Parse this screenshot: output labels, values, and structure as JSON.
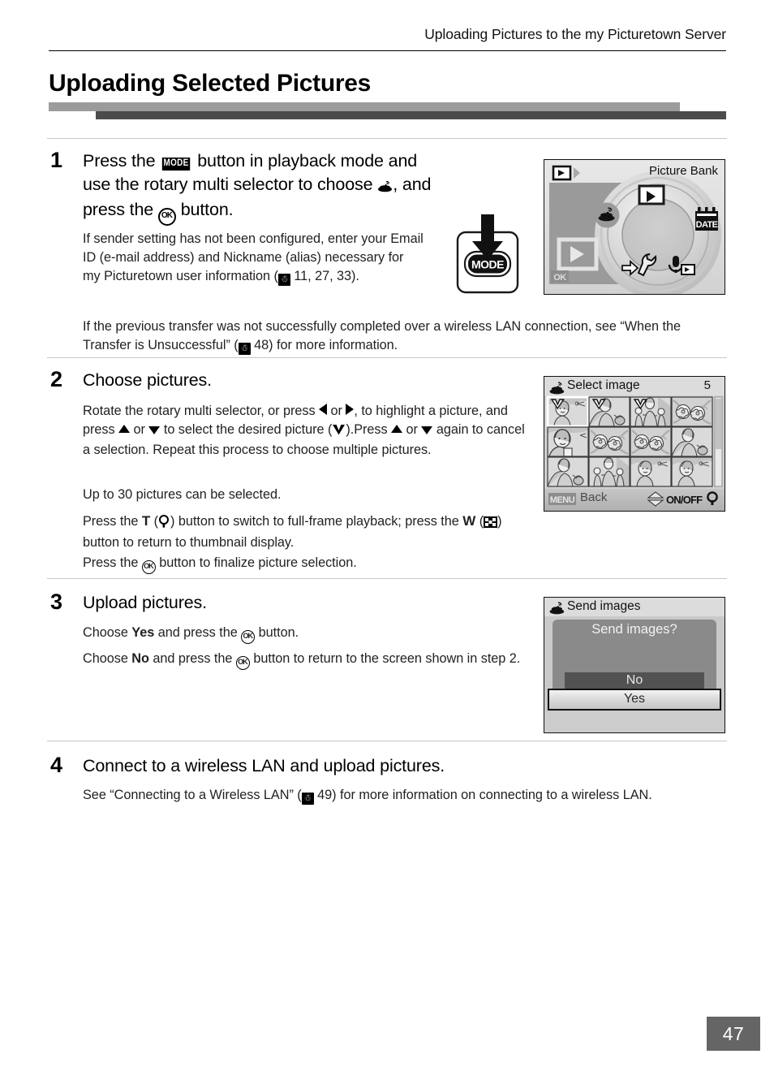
{
  "header": {
    "running_title": "Uploading Pictures to the my Picturetown Server"
  },
  "chapter": {
    "title": "Uploading Selected Pictures"
  },
  "steps": [
    {
      "number": "1",
      "heading_parts": {
        "a": "Press the ",
        "mode_icon": "MODE",
        "b": " button in playback mode and use the rotary multi selector to choose ",
        "send_icon": "send-images-icon",
        "c": ", and press the ",
        "ok_icon": "OK",
        "d": " button."
      },
      "body": [
        "If sender setting has not been configured, enter your Email ID (e-mail address) and Nickname (alias) necessary for my Picturetown user information (",
        "11, 27, 33).",
        "If the previous transfer was not successfully completed over a wireless LAN connection, see “When the Transfer is Unsuccessful” (",
        "48) for more information."
      ]
    },
    {
      "number": "2",
      "heading": "Choose pictures.",
      "body": {
        "p1_a": "Rotate the rotary multi selector, or press ",
        "p1_b": " or ",
        "p1_c": ", to highlight a picture, and press ",
        "p1_d": " or ",
        "p1_e": " to select the desired picture (",
        "p1_f": ").",
        "p2_a": "Press ",
        "p2_b": " or ",
        "p2_c": " again to cancel a selection. Repeat this process to choose multiple pictures.",
        "p3": "Up to 30 pictures can be selected.",
        "p4_a": "Press the ",
        "p4_t": "T",
        "p4_b": " (",
        "p4_c": ") button to switch to full-frame playback; press the ",
        "p4_w": "W",
        "p4_d": " (",
        "p4_e": ") button to return to thumbnail display.",
        "p5_a": "Press the ",
        "p5_ok": "OK",
        "p5_b": " button to finalize picture selection."
      }
    },
    {
      "number": "3",
      "heading": "Upload pictures.",
      "body": {
        "p1_a": "Choose ",
        "p1_yes": "Yes",
        "p1_b": " and press the ",
        "p1_ok": "OK",
        "p1_c": " button.",
        "p2_a": "Choose ",
        "p2_no": "No",
        "p2_b": " and press the ",
        "p2_ok": "OK",
        "p2_c": " button to return to the screen shown in step 2."
      }
    },
    {
      "number": "4",
      "heading": "Connect to a wireless LAN and upload pictures.",
      "body": {
        "p1_a": "See “Connecting to a Wireless LAN” (",
        "p1_ref": "49",
        "p1_b": ") for more information on connecting to a wireless LAN."
      }
    }
  ],
  "screens": {
    "picture_bank": {
      "title": "Picture Bank",
      "playback_icon": "playback-icon",
      "ok_label": "OK",
      "dial_items": [
        {
          "name": "playback-icon",
          "label": ""
        },
        {
          "name": "date-icon",
          "label": "DATE"
        },
        {
          "name": "voice-recording-icon",
          "label": ""
        },
        {
          "name": "setup-wrench-icon",
          "label": ""
        },
        {
          "name": "send-images-icon",
          "label": ""
        }
      ]
    },
    "select_image": {
      "icon": "send-images-icon",
      "title": "Select image",
      "count": "5",
      "menu_key": "MENU",
      "back_label": "Back",
      "onoff_label": "ON/OFF",
      "zoom_icon": "magnifier-icon",
      "thumbnails": [
        {
          "kind": "woman-landscape",
          "selected": true,
          "highlighted": true
        },
        {
          "kind": "woman-bag",
          "selected": true,
          "highlighted": false
        },
        {
          "kind": "family-group",
          "selected": true,
          "highlighted": false
        },
        {
          "kind": "flowers",
          "selected": false,
          "highlighted": false
        },
        {
          "kind": "woman-portrait",
          "selected": false,
          "highlighted": false
        },
        {
          "kind": "flowers",
          "selected": false,
          "highlighted": false
        },
        {
          "kind": "flowers",
          "selected": false,
          "highlighted": false
        },
        {
          "kind": "woman-bag",
          "selected": false,
          "highlighted": false
        },
        {
          "kind": "woman-bag",
          "selected": false,
          "highlighted": false
        },
        {
          "kind": "family-group",
          "selected": false,
          "highlighted": false
        },
        {
          "kind": "woman-landscape",
          "selected": false,
          "highlighted": false
        },
        {
          "kind": "woman-landscape",
          "selected": false,
          "highlighted": false
        }
      ]
    },
    "send_images": {
      "icon": "send-images-icon",
      "title": "Send images",
      "prompt": "Send images?",
      "option_no": "No",
      "option_yes": "Yes",
      "selected_option": "Yes"
    }
  },
  "footer": {
    "page_number": "47"
  },
  "colors": {
    "bar_light": "#9b9b9b",
    "bar_dark": "#4b4b4b",
    "rule": "#000000",
    "separator": "#c8c8c8",
    "page_box": "#656565",
    "screen_bg": "#d9d9d9"
  }
}
